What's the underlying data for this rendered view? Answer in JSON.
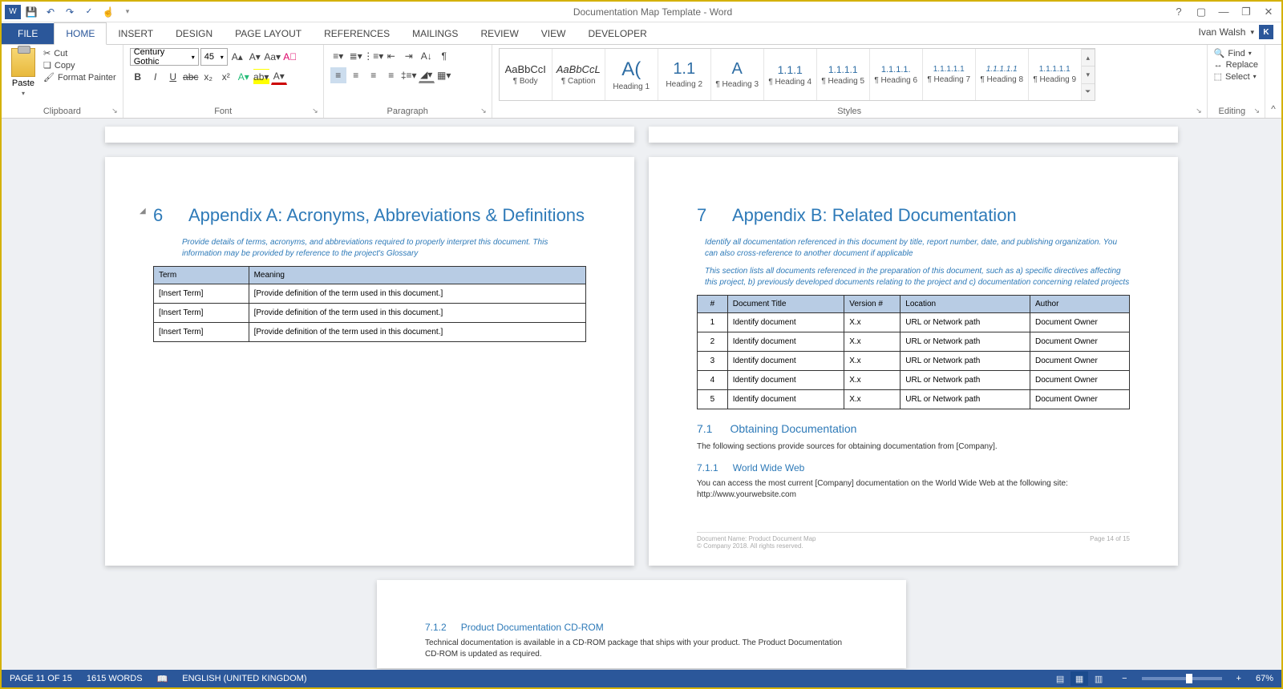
{
  "window": {
    "title": "Documentation Map Template - Word"
  },
  "qat": {
    "save": "save",
    "undo": "undo",
    "redo": "redo",
    "spell": "spell",
    "touch": "touch"
  },
  "user": {
    "name": "Ivan Walsh",
    "initial": "K"
  },
  "tabs": [
    "FILE",
    "HOME",
    "INSERT",
    "DESIGN",
    "PAGE LAYOUT",
    "REFERENCES",
    "MAILINGS",
    "REVIEW",
    "VIEW",
    "DEVELOPER"
  ],
  "ribbon": {
    "clipboard": {
      "label": "Clipboard",
      "paste": "Paste",
      "cut": "Cut",
      "copy": "Copy",
      "format_painter": "Format Painter"
    },
    "font": {
      "label": "Font",
      "name": "Century Gothic",
      "size": "45",
      "bold": "B",
      "italic": "I",
      "underline": "U"
    },
    "paragraph": {
      "label": "Paragraph"
    },
    "styles": {
      "label": "Styles",
      "items": [
        {
          "preview": "AaBbCcI",
          "name": "¶ Body"
        },
        {
          "preview": "AaBbCcL",
          "name": "¶ Caption"
        },
        {
          "preview": "A(",
          "name": "Heading 1"
        },
        {
          "preview": "1.1",
          "name": "Heading 2"
        },
        {
          "preview": "A",
          "name": "¶ Heading 3"
        },
        {
          "preview": "1.1.1",
          "name": "¶ Heading 4"
        },
        {
          "preview": "1.1.1.1",
          "name": "¶ Heading 5"
        },
        {
          "preview": "1.1.1.1.",
          "name": "¶ Heading 6"
        },
        {
          "preview": "1.1.1.1.1",
          "name": "¶ Heading 7"
        },
        {
          "preview": "1.1.1.1.1",
          "name": "¶ Heading 8"
        },
        {
          "preview": "1.1.1.1.1",
          "name": "¶ Heading 9"
        }
      ]
    },
    "editing": {
      "label": "Editing",
      "find": "Find",
      "replace": "Replace",
      "select": "Select"
    }
  },
  "doc": {
    "left": {
      "num": "6",
      "title": "Appendix A: Acronyms, Abbreviations & Definitions",
      "instr": "Provide details of terms, acronyms, and abbreviations required to properly interpret this document. This information may be provided by reference to the project's Glossary",
      "th1": "Term",
      "th2": "Meaning",
      "rows": [
        {
          "t": "[Insert Term]",
          "m": "[Provide definition of the term used in this document.]"
        },
        {
          "t": "[Insert Term]",
          "m": "[Provide definition of the term used in this document.]"
        },
        {
          "t": "[Insert Term]",
          "m": "[Provide definition of the term used in this document.]"
        }
      ]
    },
    "right": {
      "num": "7",
      "title": "Appendix B: Related Documentation",
      "instr1": "Identify all documentation referenced in this document by title, report number, date, and publishing organization. You can also cross-reference to another document if applicable",
      "instr2": "This section lists all documents referenced in the preparation of this document, such as a) specific directives affecting this project, b) previously developed documents relating to the project and c) documentation concerning related projects",
      "th": [
        "#",
        "Document Title",
        "Version #",
        "Location",
        "Author"
      ],
      "rows": [
        {
          "n": "1",
          "d": "Identify document",
          "v": "X.x",
          "l": "URL or Network path",
          "a": "Document Owner"
        },
        {
          "n": "2",
          "d": "Identify document",
          "v": "X.x",
          "l": "URL or Network path",
          "a": "Document Owner"
        },
        {
          "n": "3",
          "d": "Identify document",
          "v": "X.x",
          "l": "URL or Network path",
          "a": "Document Owner"
        },
        {
          "n": "4",
          "d": "Identify document",
          "v": "X.x",
          "l": "URL or Network path",
          "a": "Document Owner"
        },
        {
          "n": "5",
          "d": "Identify document",
          "v": "X.x",
          "l": "URL or Network path",
          "a": "Document Owner"
        }
      ],
      "h2num": "7.1",
      "h2": "Obtaining Documentation",
      "body1": "The following sections provide sources for obtaining documentation from [Company].",
      "h3num": "7.1.1",
      "h3": "World Wide Web",
      "body2": "You can access the most current [Company] documentation on the World Wide Web at the following site: http://www.yourwebsite.com",
      "foot_name": "Document Name: Product Document Map",
      "foot_copy": "© Company 2018. All rights reserved.",
      "foot_page": "Page 14 of 15"
    },
    "third": {
      "h3num": "7.1.2",
      "h3": "Product Documentation CD-ROM",
      "body": "Technical documentation is available in a CD-ROM package that ships with your product. The Product Documentation CD-ROM is updated as required."
    }
  },
  "status": {
    "page": "PAGE 11 OF 15",
    "words": "1615 WORDS",
    "lang": "ENGLISH (UNITED KINGDOM)",
    "zoom": "67%"
  }
}
